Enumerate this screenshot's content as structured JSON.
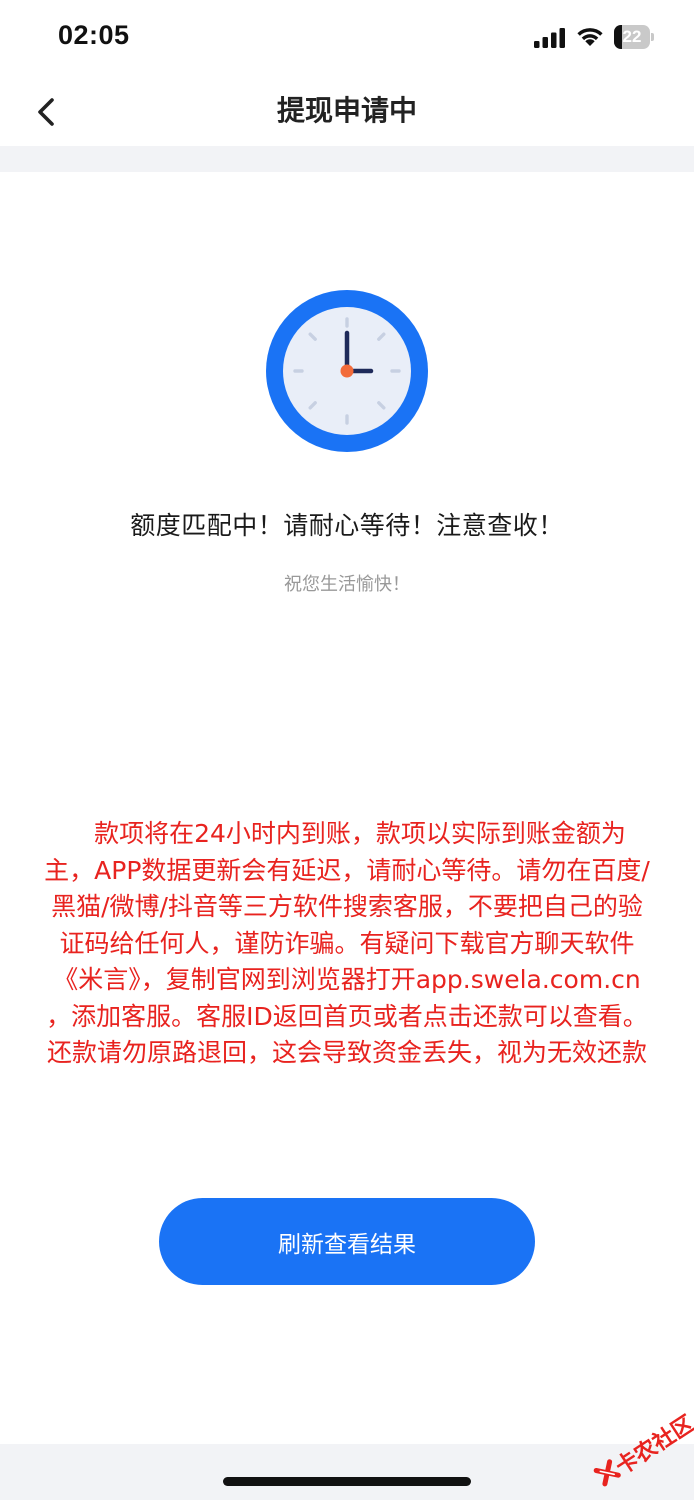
{
  "status_bar": {
    "time": "02:05",
    "battery_level": "22",
    "battery_fraction": 0.22,
    "icons": [
      "signal-icon",
      "wifi-icon",
      "battery-icon"
    ]
  },
  "nav": {
    "title": "提现申请中",
    "back_icon": "chevron-left-icon"
  },
  "main": {
    "icon": "clock-icon",
    "message": "额度匹配中！请耐心等待！注意查收！",
    "sub_message": "祝您生活愉快！",
    "notice": "款项将在24小时内到账，款项以实际到账金额为主，APP数据更新会有延迟，请耐心等待。请勿在百度/黑猫/微博/抖音等三方软件搜索客服，不要把自己的验证码给任何人，谨防诈骗。有疑问下载官方聊天软件《米言》，复制官网到浏览器打开app.swela.com.cn ，添加客服。客服ID返回首页或者点击还款可以查看。还款请勿原路退回，这会导致资金丢失，视为无效还款",
    "refresh_button": "刷新查看结果"
  },
  "watermark": {
    "text": "卡农社区"
  },
  "colors": {
    "accent_blue": "#1a73f5",
    "notice_red": "#e8231f",
    "band_gray": "#f2f3f6",
    "clock_face": "#e9eef8",
    "clock_center": "#f26b3a"
  }
}
